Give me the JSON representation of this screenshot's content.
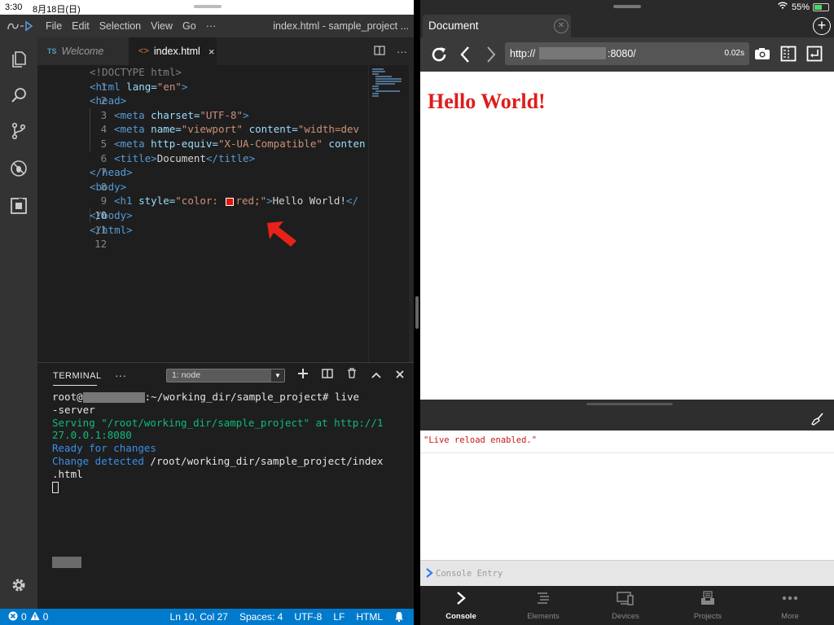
{
  "ipad_status": {
    "time": "3:30",
    "date": "8月18日(日)",
    "battery": "55%",
    "battery_level": 0.55
  },
  "vscode": {
    "menu": [
      "File",
      "Edit",
      "Selection",
      "View",
      "Go",
      "···"
    ],
    "window_title": "index.html - sample_project ...",
    "tabs": {
      "welcome_badge": "TS",
      "welcome": "Welcome",
      "index_icon": "<>",
      "index": "index.html",
      "close": "×",
      "more": "···"
    },
    "editor_lines": [
      {
        "n": "1"
      },
      {
        "n": "2"
      },
      {
        "n": "3"
      },
      {
        "n": "4"
      },
      {
        "n": "5"
      },
      {
        "n": "6"
      },
      {
        "n": "7"
      },
      {
        "n": "8"
      },
      {
        "n": "9"
      },
      {
        "n": "10"
      },
      {
        "n": "11"
      },
      {
        "n": "12"
      }
    ],
    "code": {
      "l1": "<!DOCTYPE html>",
      "l2_tag": "<html",
      "l2_attr": " lang=",
      "l2_val": "\"en\"",
      "l2_end": ">",
      "l3": "<head>",
      "l4_tag": "<meta",
      "l4_attr": " charset=",
      "l4_val": "\"UTF-8\"",
      "l4_end": ">",
      "l5_tag": "<meta",
      "l5_attr": " name=",
      "l5_val": "\"viewport\"",
      "l5_attr2": " content=",
      "l5_val2": "\"width=dev",
      "l6_tag": "<meta",
      "l6_attr": " http-equiv=",
      "l6_val": "\"X-UA-Compatible\"",
      "l6_attr2": " conten",
      "l7_tag": "<title>",
      "l7_text": "Document",
      "l7_end": "</title>",
      "l8": "</head>",
      "l9": "<body>",
      "l10_tag": "<h1",
      "l10_attr": " style=",
      "l10_val1": "\"color: ",
      "l10_val2": "red;\"",
      "l10_end": ">",
      "l10_text": "Hello World!",
      "l10_close": "</",
      "l11": "</body>",
      "l12": "</html>"
    },
    "terminal": {
      "title": "TERMINAL",
      "more": "···",
      "select_value": "1: node",
      "prompt_user": "root@",
      "prompt_path": ":~/working_dir/sample_project# live",
      "cmd_cont": "-server",
      "serving1": "Serving \"/root/working_dir/sample_project\" at http://1",
      "serving2": "27.0.0.1:8080",
      "ready": "Ready for changes",
      "change_label": "Change detected",
      "change_path": " /root/working_dir/sample_project/index",
      "change_cont": ".html"
    },
    "statusbar": {
      "errors": "0",
      "warnings": "0",
      "position": "Ln 10, Col 27",
      "spaces": "Spaces: 4",
      "encoding": "UTF-8",
      "eol": "LF",
      "language": "HTML"
    }
  },
  "browser": {
    "tab_title": "Document",
    "url_scheme": "http://",
    "url_port": ":8080/",
    "load_time": "0.02s",
    "page_heading": "Hello World!",
    "page_heading_color": "#e01b1b",
    "console_message": "\"Live reload enabled.\"",
    "console_placeholder": "Console Entry",
    "bottom_tabs": [
      "Console",
      "Elements",
      "Devices",
      "Projects",
      "More"
    ]
  },
  "colors": {
    "vscode_status": "#007acc",
    "accent_red": "#e51400"
  }
}
